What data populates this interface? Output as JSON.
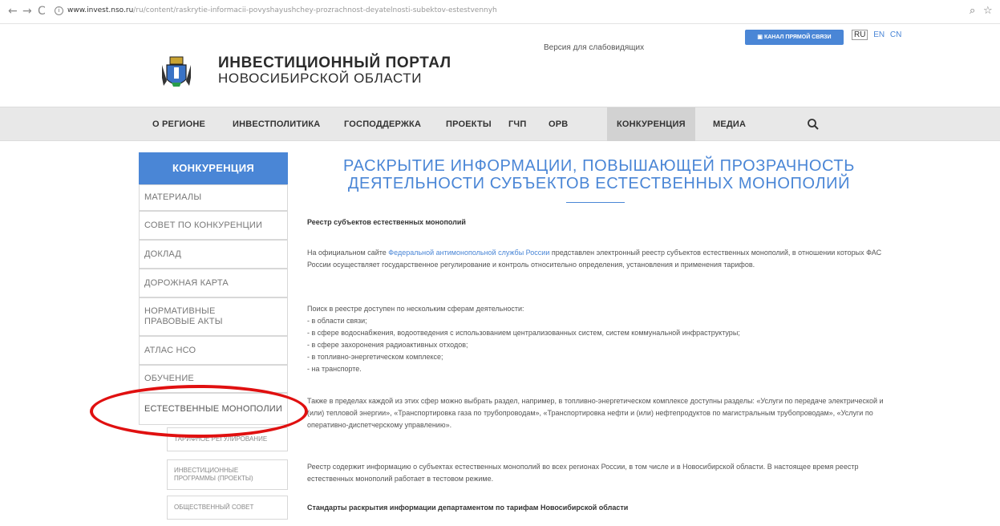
{
  "browser": {
    "back": "←",
    "forward": "→",
    "reload": "C",
    "info": "i",
    "url_host": "www.invest.nso.ru",
    "url_path": "/ru/content/raskrytie-informacii-povyshayushchey-prozrachnost-deyatelnosti-subektov-estestvennyh",
    "zoom_icon": "⌕",
    "star_icon": "☆"
  },
  "header": {
    "title": "ИНВЕСТИЦИОННЫЙ ПОРТАЛ",
    "subtitle": "НОВОСИБИРСКОЙ ОБЛАСТИ",
    "accessible_version": "Версия для слабовидящих",
    "hotline_button": "КАНАЛ ПРЯМОЙ СВЯЗИ",
    "languages": [
      "RU",
      "EN",
      "CN"
    ]
  },
  "nav": {
    "items": [
      "О РЕГИОНЕ",
      "ИНВЕСТПОЛИТИКА",
      "ГОСПОДДЕРЖКА",
      "ПРОЕКТЫ",
      "ГЧП",
      "ОРВ",
      "КОНКУРЕНЦИЯ",
      "МЕДИА"
    ],
    "active": "КОНКУРЕНЦИЯ"
  },
  "sidebar": {
    "header": "КОНКУРЕНЦИЯ",
    "items": [
      "МАТЕРИАЛЫ",
      "СОВЕТ ПО КОНКУРЕНЦИИ",
      "ДОКЛАД",
      "ДОРОЖНАЯ КАРТА",
      "НОРМАТИВНЫЕ ПРАВОВЫЕ АКТЫ",
      "АТЛАС НСО",
      "ОБУЧЕНИЕ",
      "ЕСТЕСТВЕННЫЕ МОНОПОЛИИ"
    ],
    "sub_items": [
      "ТАРИФНОЕ РЕГУЛИРОВАНИЕ",
      "ИНВЕСТИЦИОННЫЕ ПРОГРАММЫ (ПРОЕКТЫ)",
      "ОБЩЕСТВЕННЫЙ СОВЕТ"
    ]
  },
  "content": {
    "title": "РАСКРЫТИЕ ИНФОРМАЦИИ, ПОВЫШАЮЩЕЙ ПРОЗРАЧНОСТЬ ДЕЯТЕЛЬНОСТИ СУБЪЕКТОВ ЕСТЕСТВЕННЫХ МОНОПОЛИЙ",
    "registry_heading": "Реестр субъектов естественных монополий",
    "p1_before": "На официальном сайте ",
    "p1_link": "Федеральной антимонопольной службы России",
    "p1_after": " представлен электронный реестр субъектов естественных монополий, в отношении которых ФАС России осуществляет государственное регулирование и контроль относительно определения, установления и применения тарифов.",
    "search_intro": "Поиск в реестре доступен по нескольким сферам деятельности:",
    "spheres": [
      "- в области связи;",
      "- в сфере водоснабжения, водоотведения с использованием централизованных систем, систем коммунальной инфраструктуры;",
      "- в сфере захоронения радиоактивных отходов;",
      "- в топливно-энергетическом комплексе;",
      "- на транспорте."
    ],
    "p3": "Также в пределах каждой из этих сфер можно выбрать раздел, например, в топливно-энергетическом комплексе доступны разделы: «Услуги по передаче электрической и (или) тепловой энергии», «Транспортировка газа по трубопроводам», «Транспортировка нефти и (или) нефтепродуктов по магистральным трубопроводам», «Услуги по оперативно-диспетчерскому управлению».",
    "p4": "Реестр содержит информацию о субъектах естественных монополий во всех регионах России, в том числе и в Новосибирской области. В настоящее время реестр естественных монополий работает в тестовом режиме.",
    "standards_heading": "Стандарты раскрытия информации департаментом по тарифам Новосибирской области"
  },
  "colors": {
    "accent": "#4a86d6",
    "annotation": "#e01010",
    "nav_bg": "#e8e8e8"
  }
}
